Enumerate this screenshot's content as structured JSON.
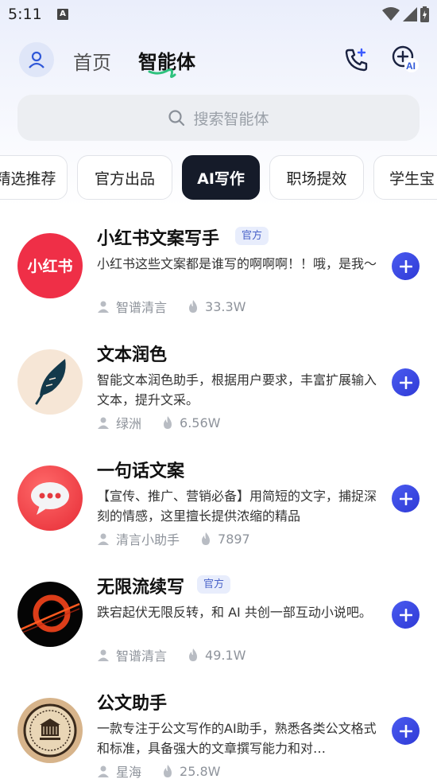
{
  "status": {
    "time": "5:11",
    "notification_letter": "A"
  },
  "header": {
    "tab_home": "首页",
    "tab_agents": "智能体"
  },
  "search": {
    "placeholder": "搜索智能体"
  },
  "categories": [
    "精选推荐",
    "官方出品",
    "AI写作",
    "职场提效",
    "学生宝"
  ],
  "active_category": "AI写作",
  "agents": [
    {
      "title": "小红书文案写手",
      "badge": "官方",
      "desc": "小红书这些文案都是谁写的啊啊啊！！哦，是我～",
      "author": "智谱清言",
      "count": "33.3W",
      "icon": "xiaohongshu-logo",
      "logo_text": "小红书"
    },
    {
      "title": "文本润色",
      "badge": "",
      "desc": "智能文本润色助手，根据用户要求，丰富扩展输入文本，提升文采。",
      "author": "绿洲",
      "count": "6.56W",
      "icon": "feather-icon"
    },
    {
      "title": "一句话文案",
      "badge": "",
      "desc": "【宣传、推广、营销必备】用简短的文字，捕捉深刻的情感，这里擅长提供浓缩的精品",
      "author": "清言小助手",
      "count": "7897",
      "icon": "chat-bubble-icon"
    },
    {
      "title": "无限流续写",
      "badge": "官方",
      "desc": "跌宕起伏无限反转，和 AI 共创一部互动小说吧。",
      "author": "智谱清言",
      "count": "49.1W",
      "icon": "black-hole-icon"
    },
    {
      "title": "公文助手",
      "badge": "",
      "desc": "一款专注于公文写作的AI助手，熟悉各类公文格式和标准，具备强大的文章撰写能力和对…",
      "author": "星海",
      "count": "25.8W",
      "icon": "seal-icon"
    }
  ],
  "colors": {
    "accent": "#3b46e0",
    "badge_bg": "#e8edfc",
    "chip_active": "#151b29"
  }
}
